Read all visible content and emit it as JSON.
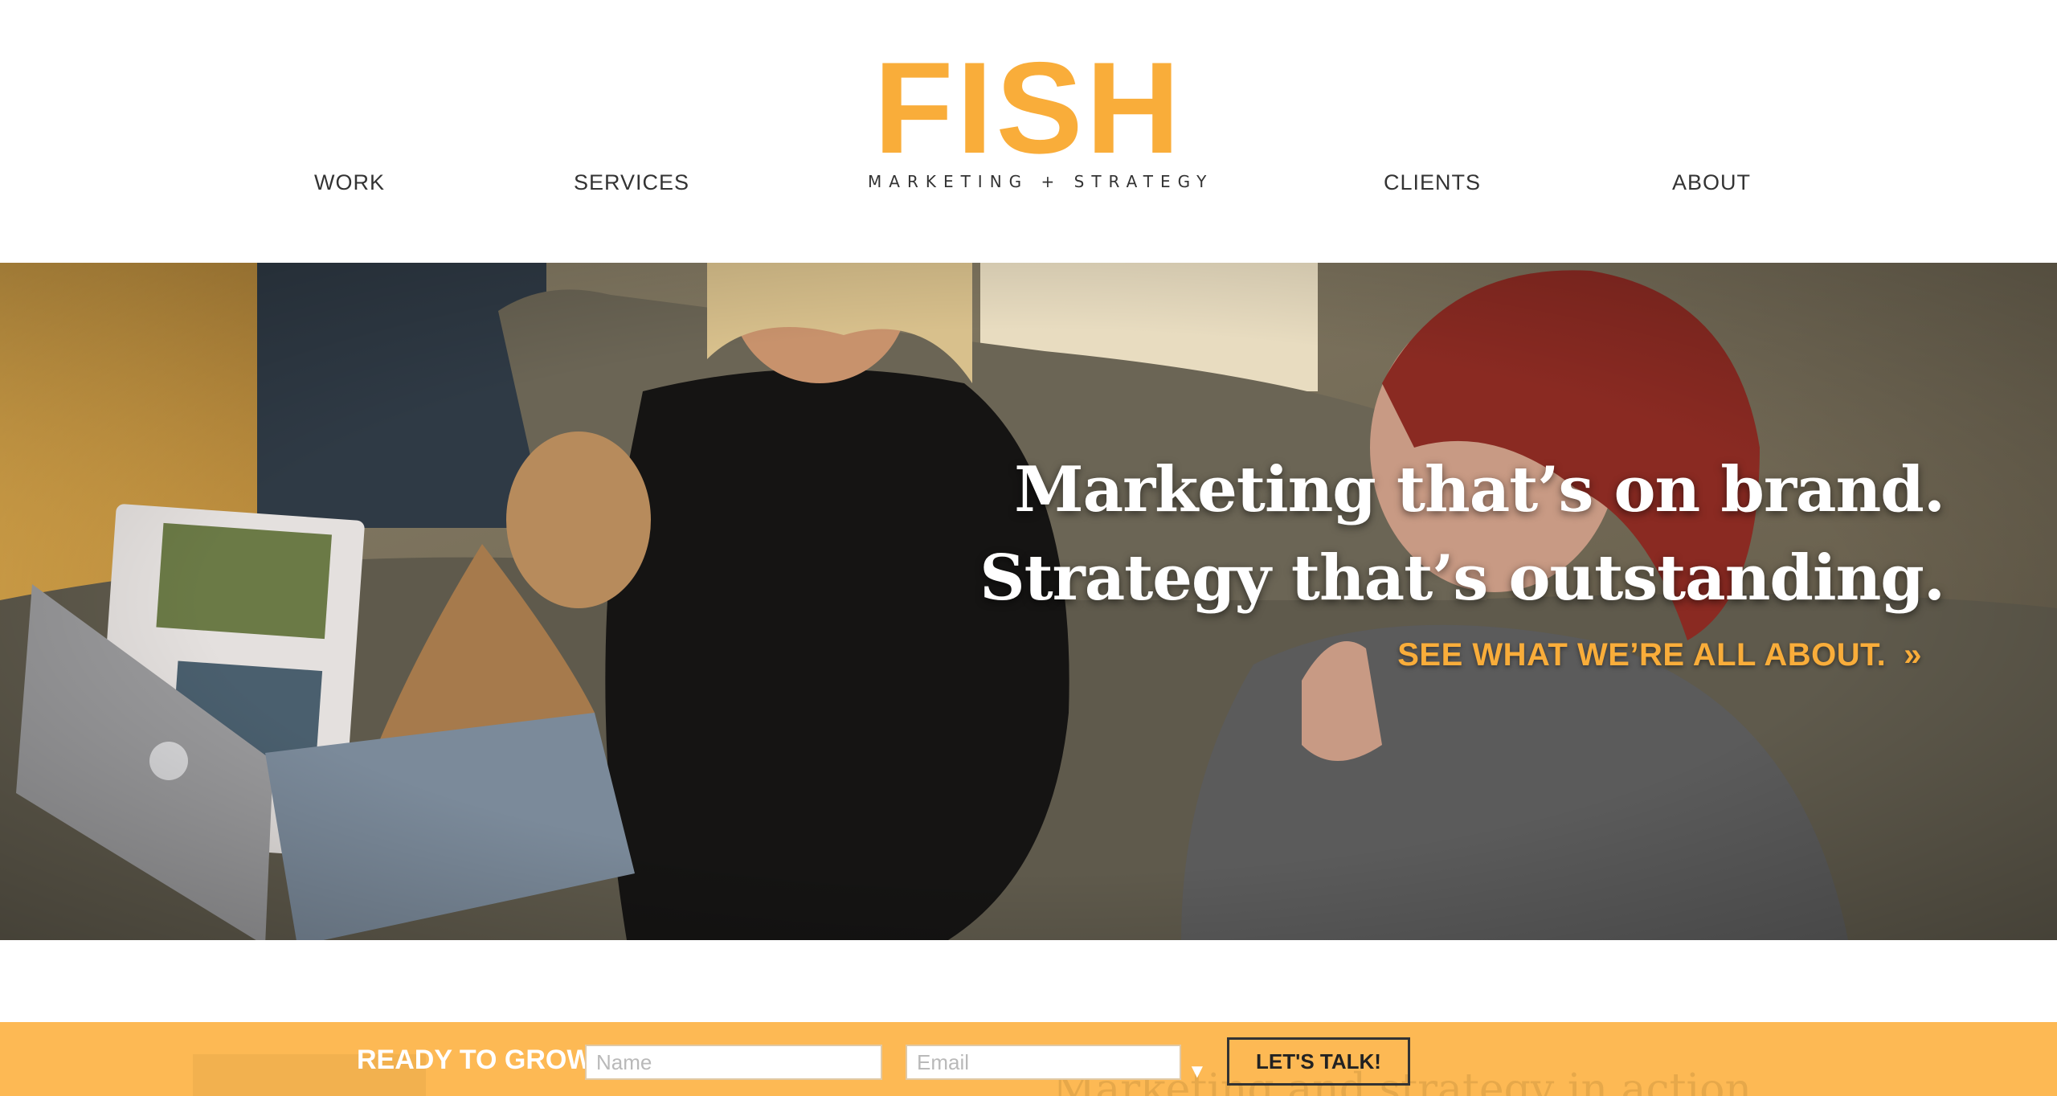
{
  "brand": {
    "name": "FISH",
    "tagline": "MARKETING + STRATEGY",
    "accent_color": "#f9ad3a"
  },
  "nav": {
    "items": [
      {
        "label": "WORK"
      },
      {
        "label": "SERVICES"
      },
      {
        "label": "CLIENTS"
      },
      {
        "label": "ABOUT"
      }
    ]
  },
  "hero": {
    "headline_line1": "Marketing that’s on brand.",
    "headline_line2": "Strategy that’s outstanding.",
    "cta_label": "SEE WHAT WE’RE ALL ABOUT.",
    "cta_arrow": "»"
  },
  "lead_bar": {
    "label": "READY TO GROW?",
    "name_placeholder": "Name",
    "email_placeholder": "Email",
    "caret": "▼",
    "button_label": "LET'S TALK!",
    "background_text": "Marketing and strategy in action",
    "bar_color": "#fdb954"
  }
}
